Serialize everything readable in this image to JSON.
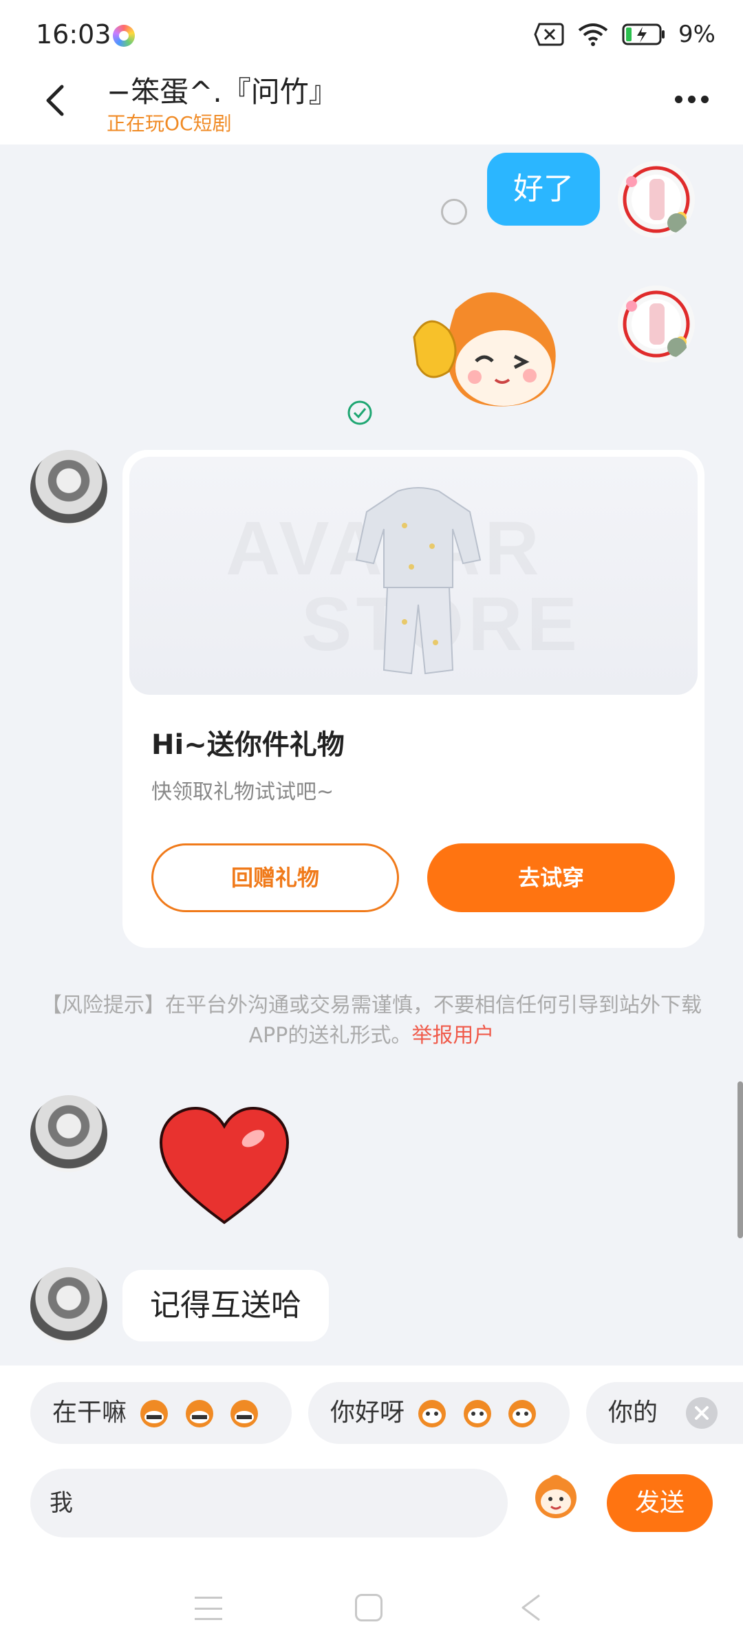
{
  "status_bar": {
    "time": "16:03",
    "battery": "9%"
  },
  "header": {
    "title": "−笨蛋^.『问竹』",
    "subtitle": "正在玩OC短剧"
  },
  "messages": {
    "out_text": "好了",
    "gift_card": {
      "watermark_1": "AVATAR",
      "watermark_2": "STORE",
      "title": "Hi~送你件礼物",
      "desc": "快领取礼物试试吧~",
      "return_button": "回赠礼物",
      "try_button": "去试穿"
    },
    "risk_note": "【风险提示】在平台外沟通或交易需谨慎，不要相信任何引导到站外下载APP的送礼形式。",
    "risk_report": "举报用户",
    "in_text": "记得互送哈"
  },
  "quick_replies": [
    "在干嘛",
    "你好呀",
    "你的"
  ],
  "input": {
    "value": "我",
    "send_label": "发送"
  },
  "colors": {
    "accent": "#ff7411",
    "bubble_out": "#2bb6ff",
    "subtitle": "#f08a24",
    "report": "#f05a4a"
  }
}
